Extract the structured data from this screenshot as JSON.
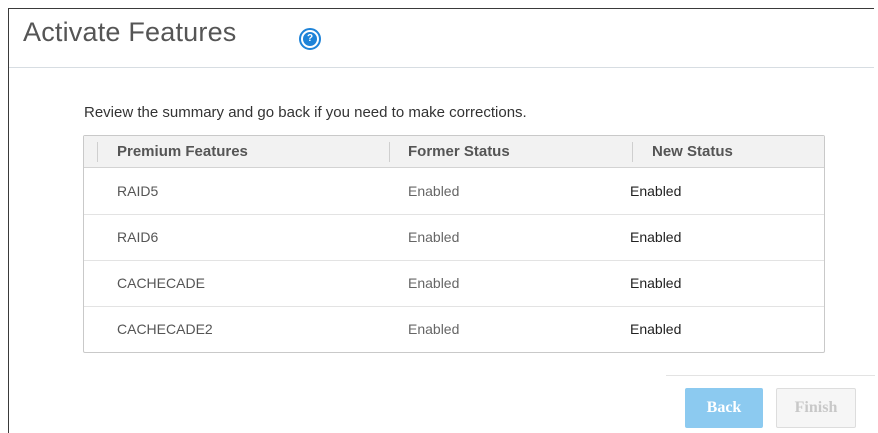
{
  "page": {
    "title": "Activate Features",
    "help_icon": "question-circle-icon",
    "help_glyph": "?"
  },
  "summary_text": "Review the summary and go back if you need to make corrections.",
  "table": {
    "headers": [
      "Premium Features",
      "Former Status",
      "New Status"
    ],
    "rows": [
      {
        "feature": "RAID5",
        "former": "Enabled",
        "new": "Enabled"
      },
      {
        "feature": "RAID6",
        "former": "Enabled",
        "new": "Enabled"
      },
      {
        "feature": "CACHECADE",
        "former": "Enabled",
        "new": "Enabled"
      },
      {
        "feature": "CACHECADE2",
        "former": "Enabled",
        "new": "Enabled"
      }
    ]
  },
  "buttons": {
    "back": "Back",
    "finish": "Finish"
  },
  "colors": {
    "help_icon": "#1e83d8",
    "back_button": "#8ccaf0",
    "finish_button_disabled": "#f6f6f6"
  }
}
